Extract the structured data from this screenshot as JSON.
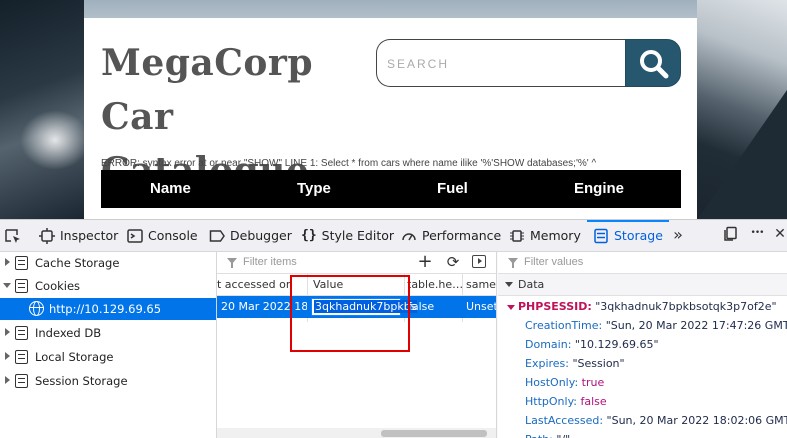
{
  "page": {
    "title": "MegaCorp Car Catalogue",
    "search_placeholder": "SEARCH",
    "error": "ERROR: syntax error at or near \"SHOW\" LINE 1: Select * from cars where name ilike '%'SHOW databases;'%' ^",
    "table_headers": [
      "Name",
      "Type",
      "Fuel",
      "Engine"
    ]
  },
  "devtools": {
    "tabs": [
      {
        "label": "Inspector",
        "icon": "inspector-icon"
      },
      {
        "label": "Console",
        "icon": "console-icon"
      },
      {
        "label": "Debugger",
        "icon": "debugger-icon"
      },
      {
        "label": "Style Editor",
        "icon": "style-editor-icon"
      },
      {
        "label": "Performance",
        "icon": "performance-icon"
      },
      {
        "label": "Memory",
        "icon": "memory-icon"
      },
      {
        "label": "Storage",
        "icon": "storage-icon"
      }
    ],
    "active_tab": "Storage",
    "more_tabs_glyph": "»",
    "overflow_glyph": "•••",
    "close_glyph": "✕",
    "sidebar": {
      "items": [
        {
          "label": "Cache Storage",
          "expanded": false
        },
        {
          "label": "Cookies",
          "expanded": true
        },
        {
          "label": "http://10.129.69.65",
          "selected": true
        },
        {
          "label": "Indexed DB",
          "expanded": false
        },
        {
          "label": "Local Storage",
          "expanded": false
        },
        {
          "label": "Session Storage",
          "expanded": false
        }
      ]
    },
    "table": {
      "filter_placeholder": "Filter items",
      "columns": [
        "t accessed on",
        "Value",
        "table.he…",
        "sameS"
      ],
      "row": {
        "accessed": "20 Mar 2022 18…",
        "value": "3qkhadnuk7bpkbs",
        "http_only": "false",
        "same_site": "Unset"
      }
    },
    "details": {
      "filter_placeholder": "Filter values",
      "section": "Data",
      "cookie_name": "PHPSESSID",
      "cookie_value": "\"3qkhadnuk7bpkbsotqk3p7of2e\"",
      "fields": [
        {
          "key": "CreationTime",
          "value": "\"Sun, 20 Mar 2022 17:47:26 GMT\"",
          "kind": "string"
        },
        {
          "key": "Domain",
          "value": "\"10.129.69.65\"",
          "kind": "string"
        },
        {
          "key": "Expires",
          "value": "\"Session\"",
          "kind": "string"
        },
        {
          "key": "HostOnly",
          "value": "true",
          "kind": "bool"
        },
        {
          "key": "HttpOnly",
          "value": "false",
          "kind": "bool"
        },
        {
          "key": "LastAccessed",
          "value": "\"Sun, 20 Mar 2022 18:02:06 GMT\"",
          "kind": "string"
        },
        {
          "key": "Path",
          "value": "\"/\"",
          "kind": "string"
        }
      ]
    }
  },
  "colors": {
    "accent": "#0074e8",
    "search_button": "#27566f",
    "highlight_box": "#e00000"
  }
}
